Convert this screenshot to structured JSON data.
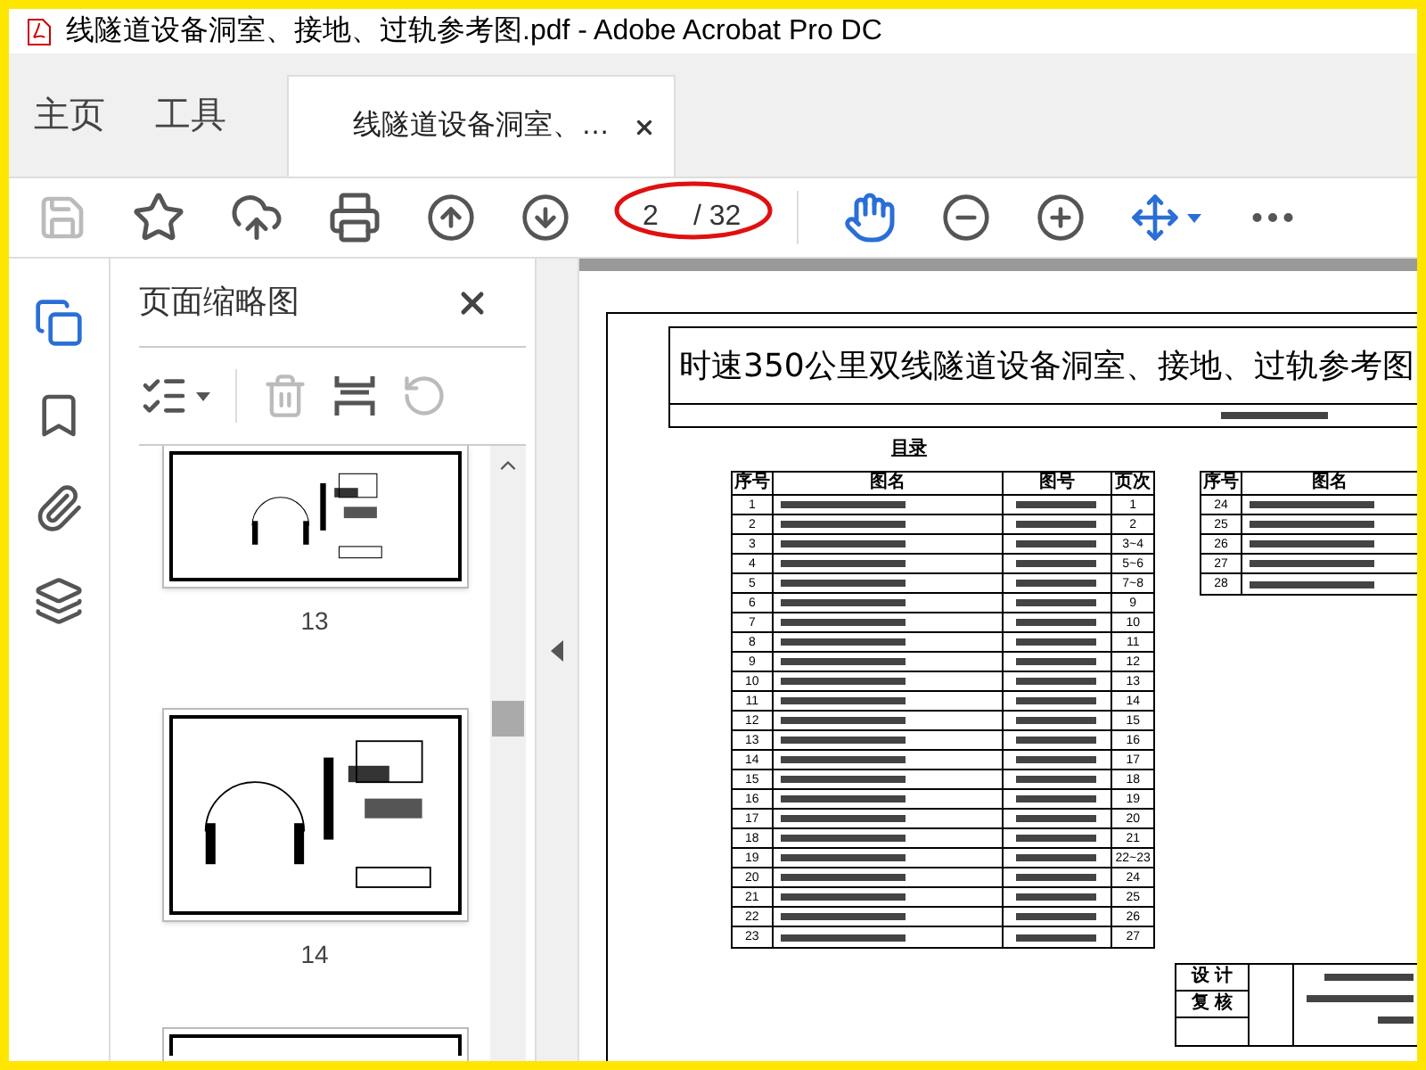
{
  "window": {
    "title": "线隧道设备洞室、接地、过轨参考图.pdf - Adobe Acrobat Pro DC"
  },
  "tabs": [
    {
      "label": "主页",
      "kind": "nav",
      "selected": false
    },
    {
      "label": "工具",
      "kind": "nav",
      "selected": false
    },
    {
      "label": "线隧道设备洞室、…",
      "kind": "document",
      "selected": true
    }
  ],
  "toolbar": {
    "save_disabled": true,
    "page_field": {
      "value": "2",
      "total": "/ 32"
    }
  },
  "sidebar": {
    "items": [
      {
        "kind": "pages",
        "selected": true
      },
      {
        "kind": "bookmarks",
        "selected": false
      },
      {
        "kind": "attachments",
        "selected": false
      },
      {
        "kind": "layers",
        "selected": false
      }
    ]
  },
  "thumbnails_panel": {
    "title": "页面缩略图",
    "thumbnails": [
      {
        "label": "13",
        "kind": "cut"
      },
      {
        "label": "14",
        "kind": "full"
      }
    ]
  },
  "document": {
    "title": "时速350公里双线隧道设备洞室、接地、过轨参考图",
    "subtitle": "目录",
    "left_table": {
      "columns": [
        "序号",
        "图名",
        "图号",
        "页次"
      ],
      "rows": [
        {
          "no": "1",
          "pages": "1"
        },
        {
          "no": "2",
          "pages": "2"
        },
        {
          "no": "3",
          "pages": "3~4"
        },
        {
          "no": "4",
          "pages": "5~6"
        },
        {
          "no": "5",
          "pages": "7~8"
        },
        {
          "no": "6",
          "pages": "9"
        },
        {
          "no": "7",
          "pages": "10"
        },
        {
          "no": "8",
          "pages": "11"
        },
        {
          "no": "9",
          "pages": "12"
        },
        {
          "no": "10",
          "pages": "13"
        },
        {
          "no": "11",
          "pages": "14"
        },
        {
          "no": "12",
          "pages": "15"
        },
        {
          "no": "13",
          "pages": "16"
        },
        {
          "no": "14",
          "pages": "17"
        },
        {
          "no": "15",
          "pages": "18"
        },
        {
          "no": "16",
          "pages": "19"
        },
        {
          "no": "17",
          "pages": "20"
        },
        {
          "no": "18",
          "pages": "21"
        },
        {
          "no": "19",
          "pages": "22~23"
        },
        {
          "no": "20",
          "pages": "24"
        },
        {
          "no": "21",
          "pages": "25"
        },
        {
          "no": "22",
          "pages": "26"
        },
        {
          "no": "23",
          "pages": "27"
        }
      ]
    },
    "right_table": {
      "columns": [
        "序号",
        "图名"
      ],
      "rows": [
        {
          "no": "24"
        },
        {
          "no": "25"
        },
        {
          "no": "26"
        },
        {
          "no": "27"
        },
        {
          "no": "28"
        }
      ]
    },
    "signoff": [
      "设 计",
      "复 核"
    ]
  }
}
